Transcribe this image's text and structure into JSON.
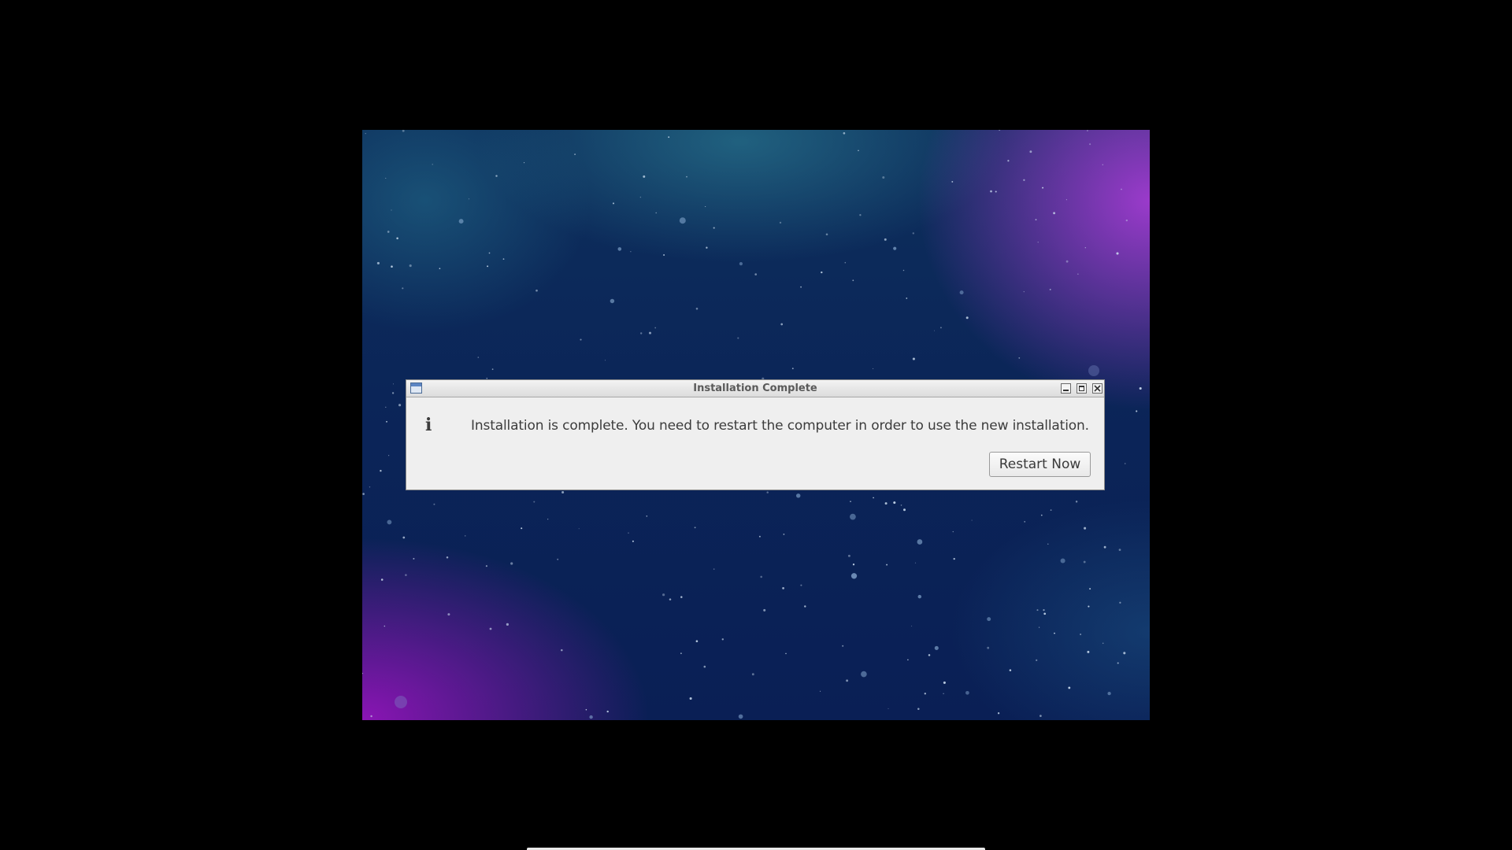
{
  "dialog": {
    "title": "Installation Complete",
    "icon": "info-icon",
    "icon_glyph": "i",
    "message": "Installation is complete. You need to restart the computer in order to use the new installation.",
    "restart_button_label": "Restart Now"
  },
  "titlebar_buttons": [
    "minimize-icon",
    "maximize-icon",
    "close-icon"
  ],
  "colors": {
    "page_background": "#000000",
    "dialog_background": "#efefef",
    "text": "#3c3c3c"
  }
}
